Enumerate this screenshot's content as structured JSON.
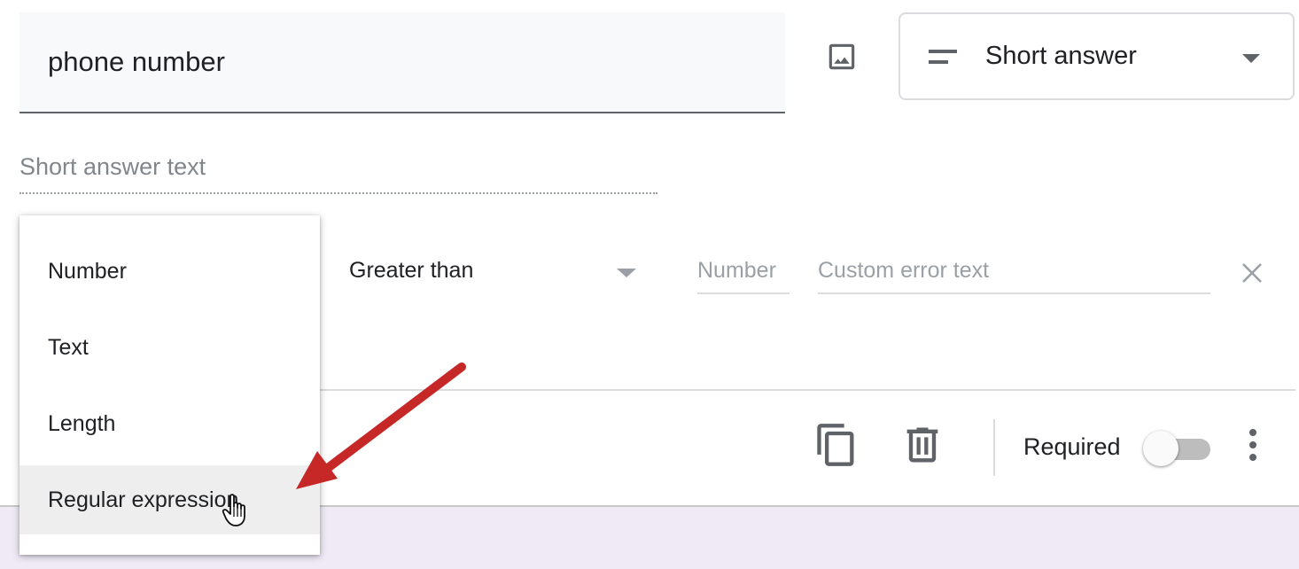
{
  "question": {
    "title": "phone number",
    "type_label": "Short answer",
    "answer_placeholder": "Short answer text"
  },
  "validation": {
    "menu_items": [
      "Number",
      "Text",
      "Length",
      "Regular expression"
    ],
    "hovered_item": "Regular expression",
    "condition": "Greater than",
    "number_placeholder": "Number",
    "error_placeholder": "Custom error text"
  },
  "footer": {
    "required_label": "Required",
    "required_on": false
  },
  "colors": {
    "annotation_arrow": "#c62828",
    "footer_band": "#efeaf6",
    "icon_gray": "#5f6368"
  },
  "icons": [
    "image-icon",
    "short-answer-icon",
    "dropdown-caret-icon",
    "close-icon",
    "duplicate-icon",
    "trash-icon",
    "more-vert-icon",
    "hand-cursor-icon"
  ]
}
